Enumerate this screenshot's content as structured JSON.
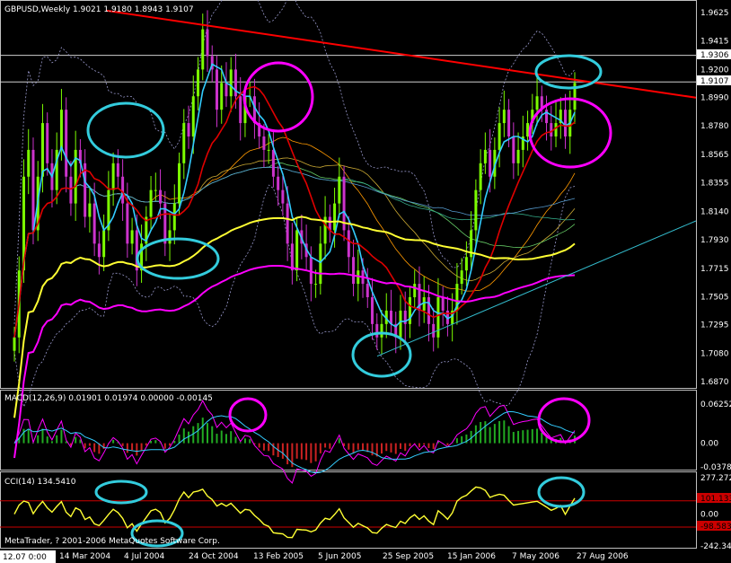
{
  "colors": {
    "background": "#000000",
    "bull_candle": "#7CFC00",
    "bear_candle": "#CC33CC",
    "trendline": "#FF0000",
    "ma_fast": "#33CCFF",
    "ma_mid": "#E00000",
    "ma_slow_yellow": "#FFFF33",
    "ma_slow_magenta": "#FF00FF",
    "bollinger": "#9999CC",
    "macd_line": "#FF00FF",
    "macd_signal": "#33CCFF",
    "macd_hist_pos": "#22AA22",
    "macd_hist_neg": "#CC2222",
    "cci_line": "#FFFF33",
    "cci_level": "#CC0000",
    "annot_cyan": "#33CCDD",
    "annot_magenta": "#FF00FF"
  },
  "main_panel": {
    "header": "GBPUSD,Weekly  1.9021 1.9180 1.8943 1.9107",
    "price_axis": [
      "1.9625",
      "1.9415",
      "1.9200",
      "1.8990",
      "1.8780",
      "1.8565",
      "1.8355",
      "1.8140",
      "1.7930",
      "1.7715",
      "1.7505",
      "1.7295",
      "1.7080",
      "1.6870"
    ],
    "tag_upper": "1.9306",
    "tag_current": "1.9107"
  },
  "macd_panel": {
    "header": "MACD(12,26,9) 0.01901 0.01974 0.00000 -0.00145",
    "axis": [
      "0.06252",
      "0.00",
      "-0.03789"
    ]
  },
  "cci_panel": {
    "header": "CCI(14) 134.5410",
    "axis": [
      "277.2720",
      "101.133",
      "0.00",
      "-98.583",
      "-242.3437"
    ],
    "tag_upper": "101.133",
    "tag_lower": "-98.583"
  },
  "footer": {
    "copyright": "MetaTrader, ? 2001-2006 MetaQuotes Software Corp."
  },
  "time_axis": {
    "first": "12.07 0:00",
    "labels": [
      "14 Mar 2004",
      "4 Jul 2004",
      "24 Oct 2004",
      "13 Feb 2005",
      "5 Jun 2005",
      "25 Sep 2005",
      "15 Jan 2006",
      "7 May 2006",
      "27 Aug 2006"
    ]
  },
  "chart_data": {
    "type": "candlestick",
    "symbol": "GBPUSD",
    "timeframe": "Weekly",
    "last_bar": {
      "open": 1.9021,
      "high": 1.918,
      "low": 1.8943,
      "close": 1.9107
    },
    "ylim": [
      1.687,
      1.9625
    ],
    "close_series": [
      1.72,
      1.77,
      1.84,
      1.86,
      1.8,
      1.84,
      1.88,
      1.85,
      1.83,
      1.86,
      1.89,
      1.84,
      1.82,
      1.86,
      1.85,
      1.81,
      1.82,
      1.79,
      1.78,
      1.8,
      1.83,
      1.85,
      1.84,
      1.82,
      1.79,
      1.8,
      1.77,
      1.79,
      1.81,
      1.83,
      1.83,
      1.82,
      1.79,
      1.8,
      1.82,
      1.85,
      1.88,
      1.87,
      1.9,
      1.92,
      1.95,
      1.93,
      1.92,
      1.89,
      1.91,
      1.9,
      1.92,
      1.9,
      1.88,
      1.9,
      1.9,
      1.88,
      1.87,
      1.86,
      1.86,
      1.84,
      1.83,
      1.82,
      1.79,
      1.77,
      1.8,
      1.79,
      1.78,
      1.76,
      1.76,
      1.79,
      1.81,
      1.8,
      1.82,
      1.84,
      1.8,
      1.78,
      1.76,
      1.77,
      1.76,
      1.75,
      1.73,
      1.72,
      1.73,
      1.74,
      1.73,
      1.72,
      1.74,
      1.73,
      1.75,
      1.76,
      1.74,
      1.75,
      1.73,
      1.72,
      1.75,
      1.74,
      1.73,
      1.74,
      1.76,
      1.77,
      1.78,
      1.8,
      1.83,
      1.85,
      1.86,
      1.84,
      1.86,
      1.88,
      1.89,
      1.87,
      1.85,
      1.86,
      1.87,
      1.88,
      1.89,
      1.9,
      1.89,
      1.88,
      1.87,
      1.88,
      1.89,
      1.87,
      1.89,
      1.91
    ],
    "macd": {
      "value": 0.01901,
      "signal": 0.01974,
      "ylim": [
        -0.03789,
        0.06252
      ]
    },
    "cci": {
      "value": 134.541,
      "levels": [
        101.133,
        -98.583
      ],
      "ylim": [
        -242.3437,
        277.272
      ]
    }
  }
}
